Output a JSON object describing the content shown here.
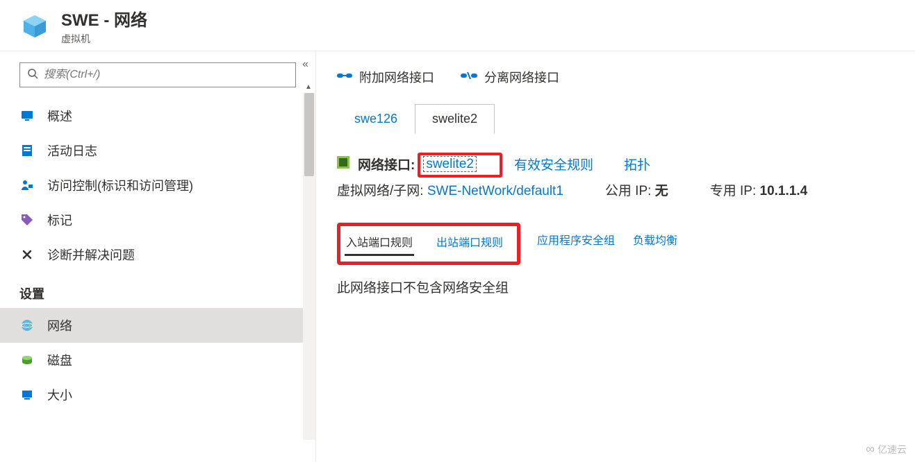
{
  "header": {
    "title": "SWE - 网络",
    "subtitle": "虚拟机"
  },
  "search": {
    "placeholder": "搜索(Ctrl+/)"
  },
  "sidebar": {
    "items": [
      {
        "label": "概述"
      },
      {
        "label": "活动日志"
      },
      {
        "label": "访问控制(标识和访问管理)"
      },
      {
        "label": "标记"
      },
      {
        "label": "诊断并解决问题"
      }
    ],
    "section": "设置",
    "settings": [
      {
        "label": "网络"
      },
      {
        "label": "磁盘"
      },
      {
        "label": "大小"
      }
    ]
  },
  "toolbar": {
    "attach": "附加网络接口",
    "detach": "分离网络接口"
  },
  "nic_tabs": {
    "tab1": "swe126",
    "tab2": "swelite2"
  },
  "interface": {
    "label": "网络接口:",
    "name": "swelite2",
    "eff_rules": "有效安全规则",
    "topology": "拓扑",
    "vnet_label": "虚拟网络/子网:",
    "vnet_value": "SWE-NetWork/default1",
    "pubip_label": "公用 IP:",
    "pubip_value": "无",
    "privip_label": "专用 IP:",
    "privip_value": "10.1.1.4"
  },
  "rule_tabs": {
    "inbound": "入站端口规则",
    "outbound": "出站端口规则",
    "asg": "应用程序安全组",
    "lb": "负载均衡"
  },
  "empty": "此网络接口不包含网络安全组",
  "watermark": "亿速云"
}
